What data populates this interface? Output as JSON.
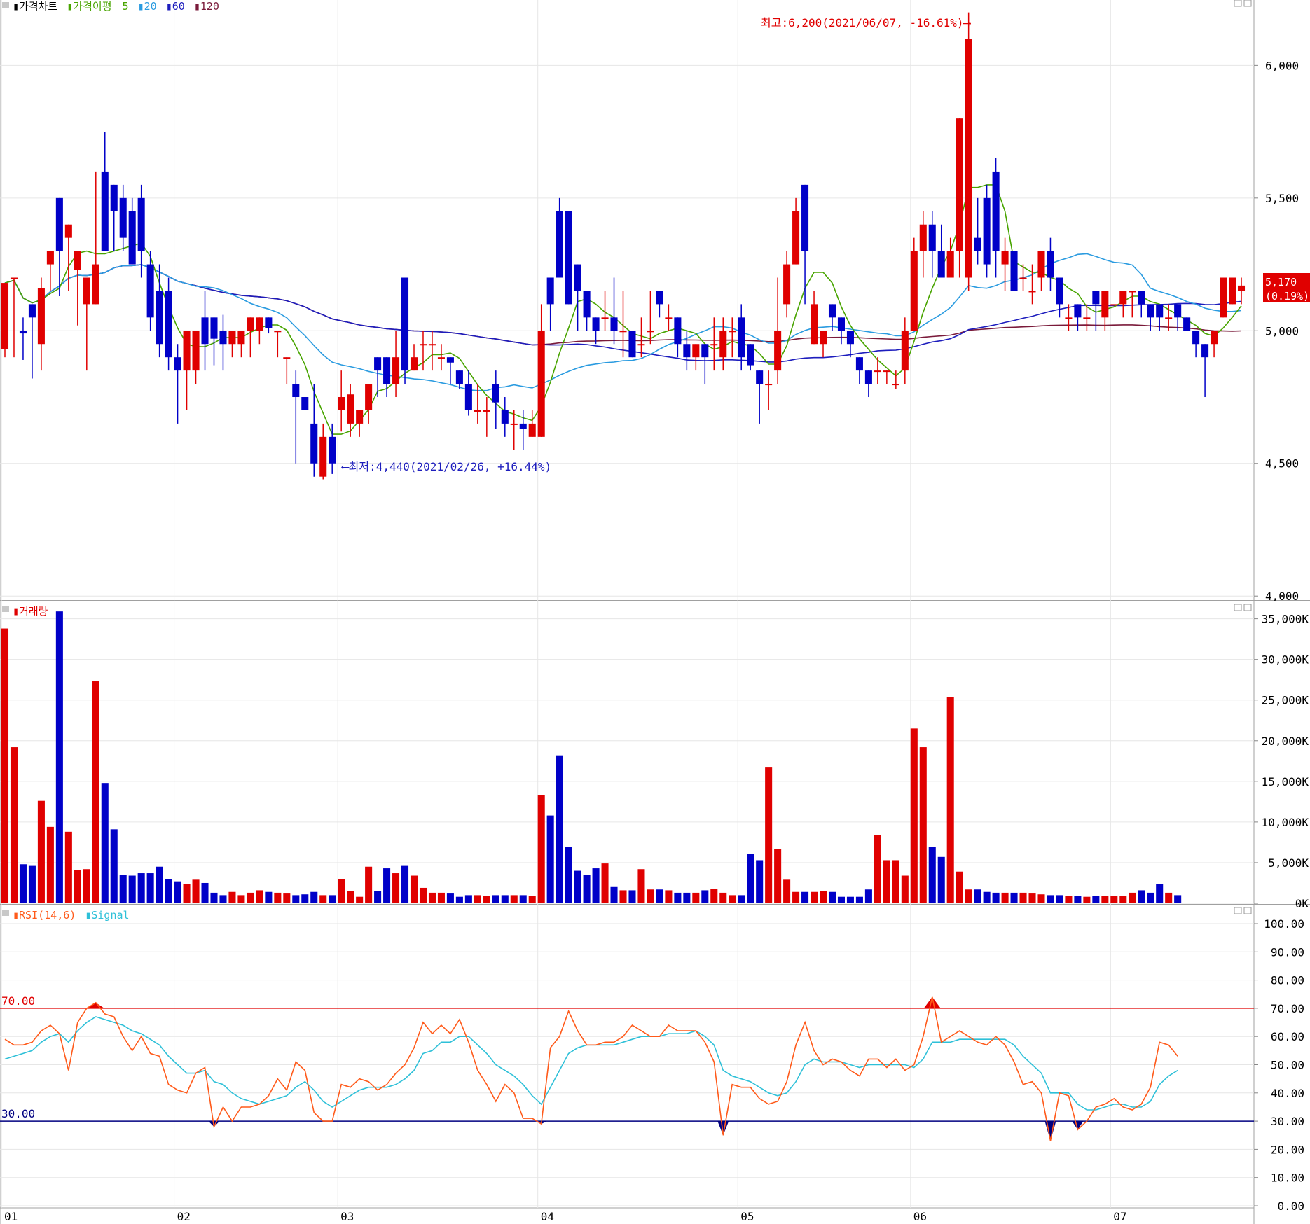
{
  "colors": {
    "up": "#e00000",
    "down": "#0000c8",
    "grid": "#e6e6e6",
    "ma5": "#48a400",
    "ma20": "#2a9be0",
    "ma60": "#1d1dbd",
    "ma120": "#7a1a3a",
    "rsi": "#ff5a1a",
    "signal": "#2ec0d8",
    "level70": "#e00000",
    "level30": "#000080"
  },
  "header": {
    "price": {
      "bullet": "▮",
      "title": "가격차트",
      "ma_label": "가격이평",
      "ma5": "5",
      "ma20": "20",
      "ma60": "60",
      "ma120": "120"
    },
    "volume": {
      "bullet": "▮",
      "title": "거래량"
    },
    "rsi": {
      "bullet": "▮",
      "title": "RSI(14,6)",
      "signal": "Signal"
    }
  },
  "annotations": {
    "high": "최고:6,200(2021/06/07, -16.61%)⟶",
    "low": "⟵최저:4,440(2021/02/26, +16.44%)",
    "current_price": "5,170",
    "current_change": "(0.19%)"
  },
  "axes": {
    "price_ticks": [
      {
        "v": 6000,
        "label": "6,000"
      },
      {
        "v": 5500,
        "label": "5,500"
      },
      {
        "v": 5000,
        "label": "5,000"
      },
      {
        "v": 4500,
        "label": "4,500"
      },
      {
        "v": 4000,
        "label": "4,000"
      }
    ],
    "volume_ticks": [
      {
        "v": 35000,
        "label": "35,000K"
      },
      {
        "v": 30000,
        "label": "30,000K"
      },
      {
        "v": 25000,
        "label": "25,000K"
      },
      {
        "v": 20000,
        "label": "20,000K"
      },
      {
        "v": 15000,
        "label": "15,000K"
      },
      {
        "v": 10000,
        "label": "10,000K"
      },
      {
        "v": 5000,
        "label": "5,000K"
      },
      {
        "v": 0,
        "label": "0K"
      }
    ],
    "rsi_ticks": [
      {
        "v": 100,
        "label": "100.00"
      },
      {
        "v": 90,
        "label": "90.00"
      },
      {
        "v": 80,
        "label": "80.00"
      },
      {
        "v": 70,
        "label": "70.00"
      },
      {
        "v": 60,
        "label": "60.00"
      },
      {
        "v": 50,
        "label": "50.00"
      },
      {
        "v": 40,
        "label": "40.00"
      },
      {
        "v": 30,
        "label": "30.00"
      },
      {
        "v": 20,
        "label": "20.00"
      },
      {
        "v": 10,
        "label": "10.00"
      },
      {
        "v": 0,
        "label": "0.00"
      }
    ],
    "rsi_levels": [
      {
        "v": 70,
        "label": "70.00"
      },
      {
        "v": 30,
        "label": "30.00"
      }
    ],
    "months": [
      {
        "label": "01",
        "i": 0
      },
      {
        "label": "02",
        "i": 19
      },
      {
        "label": "03",
        "i": 37
      },
      {
        "label": "04",
        "i": 59
      },
      {
        "label": "05",
        "i": 81
      },
      {
        "label": "06",
        "i": 100
      },
      {
        "label": "07",
        "i": 122
      }
    ]
  },
  "chart_data": {
    "type": "candlestick",
    "price_range": [
      3990,
      6220
    ],
    "volume_range_k": [
      0,
      36000
    ],
    "rsi_range": [
      0,
      100
    ],
    "candles": [
      [
        4930,
        5180,
        4920,
        4900
      ],
      [
        5200,
        5200,
        5000,
        4900
      ],
      [
        5000,
        4990,
        5050,
        4890
      ],
      [
        5100,
        5050,
        5100,
        4820
      ],
      [
        4950,
        5160,
        5200,
        4850
      ],
      [
        5250,
        5300,
        5180,
        5150
      ],
      [
        5500,
        5300,
        5230,
        5130
      ],
      [
        5350,
        5400,
        5050,
        5150
      ],
      [
        5230,
        5300,
        5200,
        5020
      ],
      [
        5100,
        5200,
        5150,
        4850
      ],
      [
        5100,
        5250,
        5600,
        5200
      ],
      [
        5600,
        5300,
        5750,
        5300
      ],
      [
        5550,
        5450,
        5500,
        5300
      ],
      [
        5500,
        5350,
        5550,
        5300
      ],
      [
        5450,
        5250,
        5500,
        5250
      ],
      [
        5500,
        5300,
        5550,
        5200
      ],
      [
        5250,
        5050,
        5300,
        5000
      ],
      [
        5150,
        4950,
        5250,
        4900
      ],
      [
        5150,
        4900,
        5200,
        4850
      ],
      [
        4900,
        4850,
        4950,
        4650
      ],
      [
        4850,
        5000,
        4950,
        4700
      ],
      [
        4850,
        5000,
        5000,
        4800
      ],
      [
        5050,
        4950,
        5150,
        4850
      ],
      [
        5050,
        4970,
        5050,
        4870
      ],
      [
        5000,
        4950,
        5060,
        4850
      ],
      [
        4950,
        5000,
        5000,
        4900
      ],
      [
        4950,
        5000,
        4950,
        4900
      ],
      [
        5000,
        5050,
        5050,
        4900
      ],
      [
        5000,
        5050,
        5000,
        4950
      ],
      [
        5050,
        5010,
        5050,
        4990
      ],
      [
        5000,
        5000,
        4950,
        4900
      ],
      [
        4900,
        4900,
        4870,
        4800
      ],
      [
        4800,
        4750,
        4850,
        4500
      ],
      [
        4750,
        4700,
        4650,
        4700
      ],
      [
        4650,
        4500,
        4800,
        4450
      ],
      [
        4450,
        4600,
        4650,
        4440
      ],
      [
        4600,
        4500,
        4650,
        4460
      ],
      [
        4700,
        4750,
        4850,
        4620
      ],
      [
        4650,
        4760,
        4800,
        4600
      ],
      [
        4650,
        4700,
        4700,
        4600
      ],
      [
        4700,
        4800,
        4800,
        4650
      ],
      [
        4900,
        4850,
        4900,
        4750
      ],
      [
        4900,
        4800,
        4900,
        4750
      ],
      [
        4800,
        4900,
        5000,
        4750
      ],
      [
        5200,
        4850,
        5200,
        4800
      ],
      [
        4850,
        4900,
        4950,
        4850
      ],
      [
        4950,
        4950,
        5000,
        4850
      ],
      [
        4950,
        4950,
        5000,
        4850
      ],
      [
        4900,
        4900,
        4950,
        4850
      ],
      [
        4900,
        4880,
        4900,
        4800
      ],
      [
        4850,
        4800,
        4850,
        4780
      ],
      [
        4800,
        4700,
        4850,
        4680
      ],
      [
        4700,
        4700,
        4800,
        4650
      ],
      [
        4700,
        4700,
        4750,
        4600
      ],
      [
        4800,
        4730,
        4850,
        4630
      ],
      [
        4700,
        4650,
        4750,
        4600
      ],
      [
        4650,
        4650,
        4700,
        4550
      ],
      [
        4650,
        4630,
        4700,
        4550
      ],
      [
        4600,
        4650,
        4700,
        4600
      ],
      [
        4600,
        5000,
        5100,
        4600
      ],
      [
        5200,
        5100,
        5200,
        5000
      ],
      [
        5450,
        5200,
        5500,
        5200
      ],
      [
        5450,
        5100,
        5400,
        5100
      ],
      [
        5250,
        5150,
        5250,
        5000
      ],
      [
        5150,
        5050,
        5150,
        5000
      ],
      [
        5050,
        5000,
        5000,
        4950
      ],
      [
        5050,
        5050,
        5150,
        5000
      ],
      [
        5050,
        5000,
        5200,
        4950
      ],
      [
        5000,
        5000,
        5150,
        4900
      ],
      [
        5000,
        4900,
        4950,
        4900
      ],
      [
        4950,
        4950,
        5050,
        4900
      ],
      [
        5000,
        5000,
        5150,
        4950
      ],
      [
        5150,
        5100,
        5150,
        5050
      ],
      [
        5050,
        5050,
        5100,
        5000
      ],
      [
        5050,
        4950,
        5000,
        4900
      ],
      [
        4950,
        4900,
        5000,
        4850
      ],
      [
        4900,
        4950,
        4950,
        4850
      ],
      [
        4950,
        4900,
        4950,
        4800
      ],
      [
        4950,
        4950,
        5050,
        4850
      ],
      [
        4900,
        5000,
        5050,
        4850
      ],
      [
        5000,
        5000,
        5050,
        4900
      ],
      [
        5050,
        4900,
        5100,
        4850
      ],
      [
        4950,
        4870,
        4950,
        4850
      ],
      [
        4850,
        4800,
        4850,
        4650
      ],
      [
        4800,
        4800,
        4850,
        4700
      ],
      [
        4850,
        5000,
        5200,
        4800
      ],
      [
        5100,
        5250,
        5300,
        5050
      ],
      [
        5250,
        5450,
        5500,
        5250
      ],
      [
        5550,
        5300,
        5350,
        5100
      ],
      [
        4950,
        5100,
        5150,
        4950
      ],
      [
        4950,
        5000,
        4950,
        4900
      ],
      [
        5100,
        5050,
        5100,
        5000
      ],
      [
        5050,
        5000,
        5050,
        4950
      ],
      [
        5000,
        4950,
        5000,
        4900
      ],
      [
        4900,
        4850,
        4900,
        4800
      ],
      [
        4850,
        4800,
        4850,
        4750
      ],
      [
        4850,
        4850,
        4900,
        4800
      ],
      [
        4850,
        4850,
        4850,
        4800
      ],
      [
        4800,
        4800,
        4850,
        4780
      ],
      [
        4850,
        5000,
        5050,
        4800
      ],
      [
        5000,
        5300,
        5350,
        5000
      ],
      [
        5300,
        5400,
        5450,
        5200
      ],
      [
        5400,
        5300,
        5450,
        5200
      ],
      [
        5300,
        5200,
        5400,
        5200
      ],
      [
        5200,
        5300,
        5350,
        5200
      ],
      [
        5300,
        5800,
        5750,
        5200
      ],
      [
        5200,
        6100,
        6200,
        5150
      ],
      [
        5350,
        5300,
        5500,
        5250
      ],
      [
        5500,
        5250,
        5550,
        5200
      ],
      [
        5600,
        5300,
        5650,
        5200
      ],
      [
        5250,
        5300,
        5350,
        5150
      ],
      [
        5300,
        5150,
        5300,
        5150
      ],
      [
        5200,
        5200,
        5250,
        5150
      ],
      [
        5150,
        5150,
        5250,
        5100
      ],
      [
        5200,
        5300,
        5300,
        5150
      ],
      [
        5300,
        5200,
        5350,
        5150
      ],
      [
        5200,
        5100,
        5200,
        5050
      ],
      [
        5050,
        5050,
        5100,
        5000
      ],
      [
        5100,
        5050,
        5100,
        5000
      ],
      [
        5050,
        5050,
        5100,
        5000
      ],
      [
        5150,
        5100,
        5100,
        5000
      ],
      [
        5050,
        5150,
        5150,
        5000
      ],
      [
        5100,
        5100,
        5100,
        5100
      ],
      [
        5100,
        5150,
        5150,
        5050
      ],
      [
        5150,
        5150,
        5150,
        5050
      ],
      [
        5150,
        5100,
        5150,
        5050
      ],
      [
        5100,
        5050,
        5100,
        5000
      ],
      [
        5100,
        5050,
        5100,
        5000
      ],
      [
        5050,
        5050,
        5100,
        5000
      ],
      [
        5100,
        5050,
        5100,
        5000
      ],
      [
        5050,
        5000,
        5050,
        5000
      ],
      [
        5000,
        4950,
        5000,
        4900
      ],
      [
        4950,
        4900,
        4950,
        4750
      ],
      [
        4950,
        5000,
        5000,
        4900
      ],
      [
        5050,
        5200,
        5200,
        5050
      ],
      [
        5100,
        5200,
        5150,
        5100
      ],
      [
        5150,
        5170,
        5200,
        5100
      ]
    ],
    "volume_k": [
      33800,
      19200,
      4800,
      4600,
      12600,
      9400,
      35900,
      8800,
      4100,
      4200,
      27300,
      14800,
      9100,
      3500,
      3400,
      3700,
      3700,
      4500,
      3000,
      2700,
      2400,
      2900,
      2500,
      1300,
      1000,
      1400,
      1000,
      1300,
      1600,
      1400,
      1300,
      1200,
      1000,
      1100,
      1400,
      1000,
      1000,
      3000,
      1500,
      800,
      4500,
      1500,
      4300,
      3700,
      4600,
      3400,
      1900,
      1300,
      1300,
      1200,
      800,
      1000,
      1000,
      900,
      1000,
      1000,
      1000,
      1000,
      900,
      13300,
      10800,
      18200,
      6900,
      4000,
      3500,
      4300,
      4900,
      2000,
      1600,
      1600,
      4200,
      1700,
      1700,
      1600,
      1300,
      1300,
      1300,
      1600,
      1800,
      1300,
      1000,
      1000,
      6100,
      5300,
      16700,
      6700,
      2900,
      1400,
      1400,
      1400,
      1500,
      1400,
      800,
      800,
      800,
      1700,
      8400,
      5300,
      5300,
      3400,
      21500,
      19200,
      6900,
      5700,
      25400,
      3900,
      1700,
      1700,
      1400,
      1300,
      1300,
      1300,
      1300,
      1200,
      1100,
      1000,
      1000,
      900,
      900,
      800,
      900,
      900,
      900,
      900,
      1300,
      1600,
      1300,
      2400,
      1300,
      1000
    ],
    "rsi": [
      59,
      57,
      57,
      58,
      62,
      64,
      61,
      48,
      65,
      70,
      72,
      68,
      67,
      60,
      55,
      60,
      54,
      53,
      43,
      41,
      40,
      47,
      49,
      28,
      35,
      30,
      35,
      35,
      36,
      39,
      45,
      41,
      51,
      48,
      33,
      30,
      30,
      43,
      42,
      45,
      44,
      41,
      43,
      47,
      50,
      56,
      65,
      61,
      64,
      61,
      66,
      58,
      48,
      43,
      37,
      43,
      40,
      31,
      31,
      29,
      56,
      60,
      69,
      62,
      57,
      57,
      58,
      58,
      60,
      64,
      62,
      60,
      60,
      64,
      62,
      62,
      62,
      58,
      51,
      25,
      43,
      42,
      42,
      38,
      36,
      37,
      44,
      57,
      65,
      55,
      50,
      52,
      51,
      48,
      46,
      52,
      52,
      49,
      52,
      48,
      50,
      60,
      74,
      58,
      60,
      62,
      60,
      58,
      57,
      60,
      57,
      51,
      43,
      44,
      40,
      23,
      40,
      39,
      27,
      30,
      35,
      36,
      38,
      35,
      34,
      36,
      42,
      58,
      57,
      53
    ],
    "signal": [
      52,
      53,
      54,
      55,
      58,
      60,
      61,
      58,
      62,
      65,
      67,
      66,
      65,
      64,
      62,
      61,
      59,
      57,
      53,
      50,
      47,
      47,
      48,
      44,
      43,
      40,
      38,
      37,
      36,
      37,
      38,
      39,
      42,
      44,
      41,
      37,
      35,
      37,
      39,
      41,
      42,
      42,
      42,
      43,
      45,
      48,
      54,
      55,
      58,
      58,
      60,
      60,
      57,
      54,
      50,
      48,
      46,
      43,
      39,
      36,
      42,
      48,
      54,
      56,
      57,
      57,
      57,
      57,
      58,
      59,
      60,
      60,
      60,
      61,
      61,
      61,
      62,
      60,
      57,
      48,
      46,
      45,
      44,
      42,
      40,
      39,
      40,
      44,
      50,
      52,
      51,
      51,
      51,
      50,
      49,
      50,
      50,
      50,
      50,
      50,
      49,
      52,
      58,
      58,
      58,
      59,
      59,
      59,
      59,
      59,
      59,
      57,
      53,
      50,
      47,
      40,
      40,
      40,
      36,
      34,
      34,
      35,
      36,
      36,
      35,
      35,
      37,
      43,
      46,
      48
    ]
  }
}
